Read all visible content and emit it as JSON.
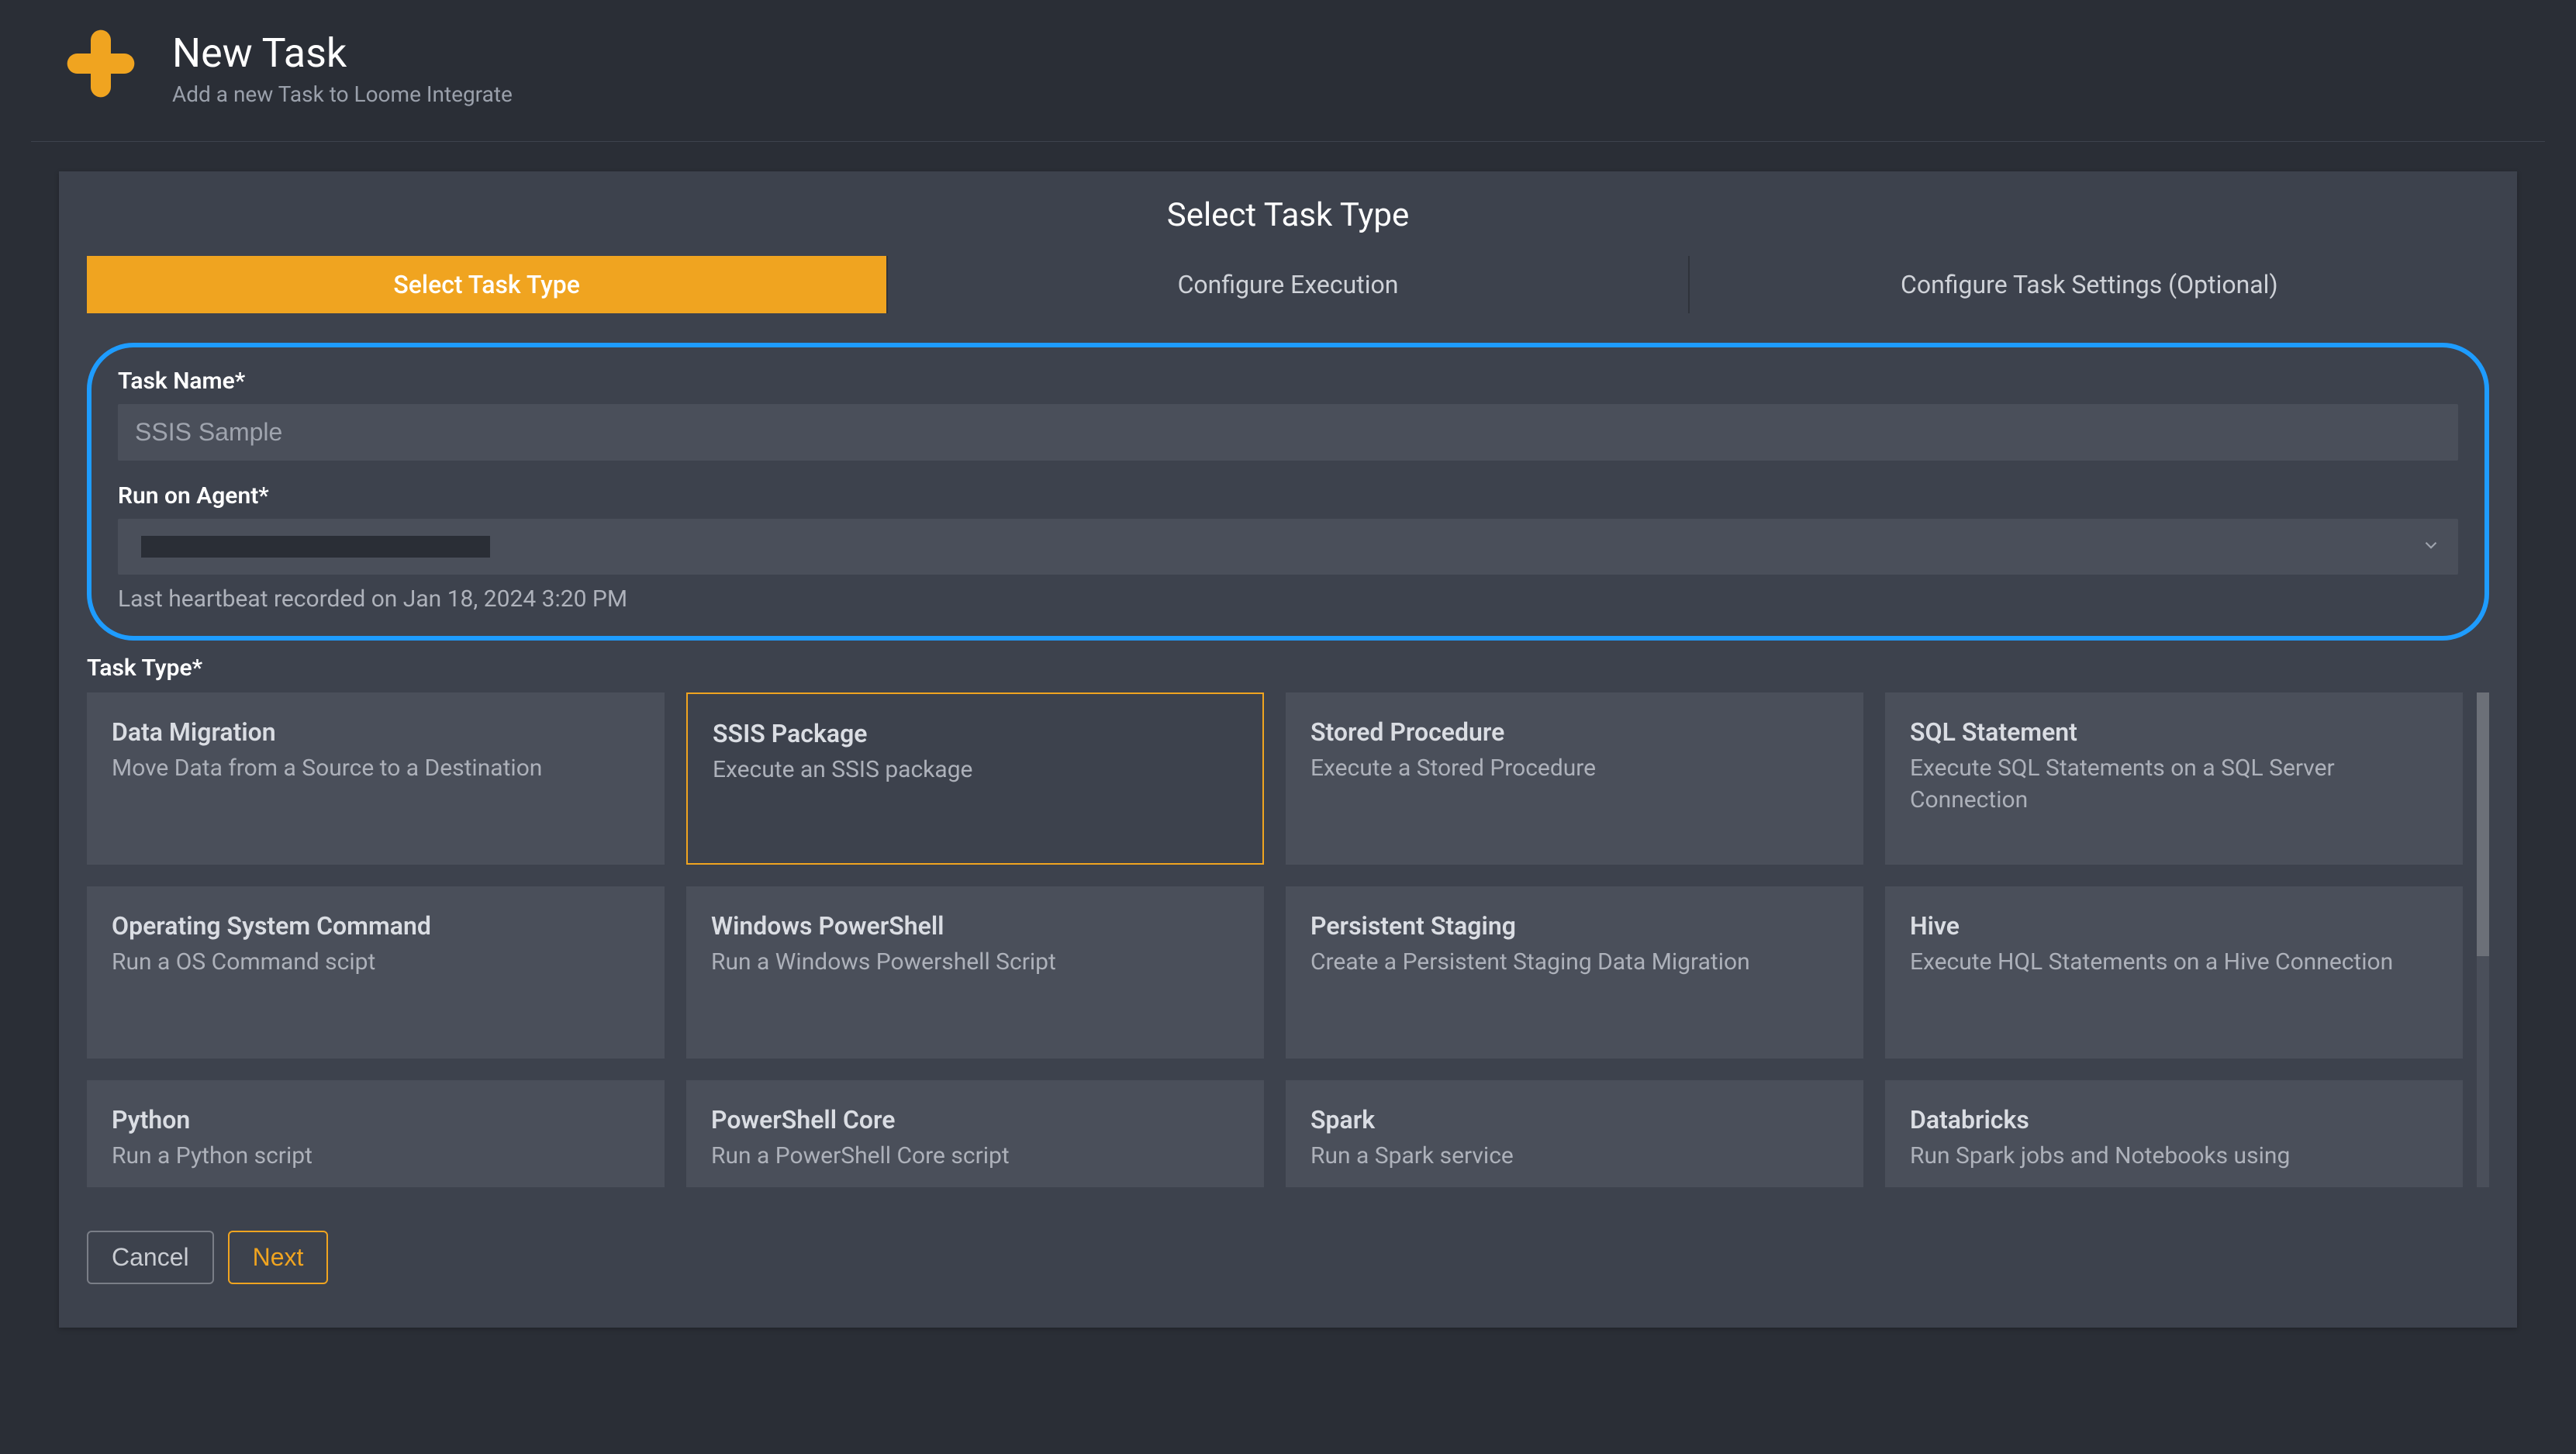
{
  "header": {
    "title": "New Task",
    "subtitle": "Add a new Task to Loome Integrate"
  },
  "panel": {
    "title": "Select Task Type"
  },
  "tabs": [
    {
      "label": "Select Task Type",
      "active": true
    },
    {
      "label": "Configure Execution",
      "active": false
    },
    {
      "label": "Configure Task Settings (Optional)",
      "active": false
    }
  ],
  "fields": {
    "task_name_label": "Task Name*",
    "task_name_placeholder": "SSIS Sample",
    "run_on_agent_label": "Run on Agent*",
    "agent_hint": "Last heartbeat recorded on Jan 18, 2024 3:20 PM",
    "task_type_label": "Task Type*"
  },
  "task_types": [
    {
      "title": "Data Migration",
      "desc": "Move Data from a Source to a Destination",
      "selected": false
    },
    {
      "title": "SSIS Package",
      "desc": "Execute an SSIS package",
      "selected": true
    },
    {
      "title": "Stored Procedure",
      "desc": "Execute a Stored Procedure",
      "selected": false
    },
    {
      "title": "SQL Statement",
      "desc": "Execute SQL Statements on a SQL Server Connection",
      "selected": false
    },
    {
      "title": "Operating System Command",
      "desc": "Run a OS Command scipt",
      "selected": false
    },
    {
      "title": "Windows PowerShell",
      "desc": "Run a Windows Powershell Script",
      "selected": false
    },
    {
      "title": "Persistent Staging",
      "desc": "Create a Persistent Staging Data Migration",
      "selected": false
    },
    {
      "title": "Hive",
      "desc": "Execute HQL Statements on a Hive Connection",
      "selected": false
    },
    {
      "title": "Python",
      "desc": "Run a Python script",
      "selected": false
    },
    {
      "title": "PowerShell Core",
      "desc": "Run a PowerShell Core script",
      "selected": false
    },
    {
      "title": "Spark",
      "desc": "Run a Spark service",
      "selected": false
    },
    {
      "title": "Databricks",
      "desc": "Run Spark jobs and Notebooks using",
      "selected": false
    }
  ],
  "buttons": {
    "cancel": "Cancel",
    "next": "Next"
  }
}
